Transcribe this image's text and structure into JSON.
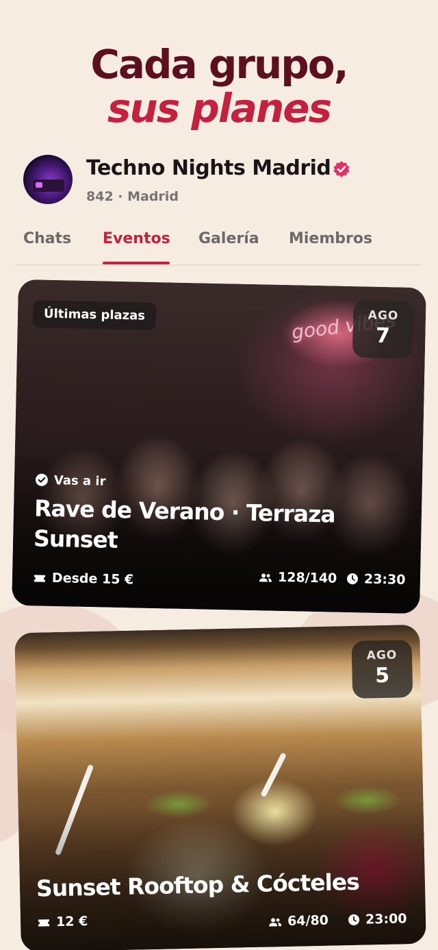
{
  "headline": {
    "line1": "Cada grupo,",
    "line2": "sus planes"
  },
  "group": {
    "name": "Techno Nights Madrid",
    "meta": "842 · Madrid",
    "verified_icon": "verified-badge-icon",
    "avatar": "dj-avatar"
  },
  "tabs": [
    {
      "label": "Chats",
      "active": false
    },
    {
      "label": "Eventos",
      "active": true
    },
    {
      "label": "Galería",
      "active": false
    },
    {
      "label": "Miembros",
      "active": false
    }
  ],
  "events": [
    {
      "badge": "Últimas plazas",
      "month": "AGO",
      "day": "7",
      "status": "Vas a ir",
      "title_line1": "Rave de Verano · Terraza",
      "title_line2": "Sunset",
      "price": "Desde 15 €",
      "attendees": "128/140",
      "time": "23:30"
    },
    {
      "month": "AGO",
      "day": "5",
      "title": "Sunset Rooftop & Cócteles",
      "price": "12 €",
      "attendees": "64/80",
      "time": "23:00"
    }
  ],
  "colors": {
    "background": "#f6ece2",
    "brand_dark": "#5c0f1e",
    "brand_accent": "#c4213f",
    "verified": "#e0316a"
  }
}
